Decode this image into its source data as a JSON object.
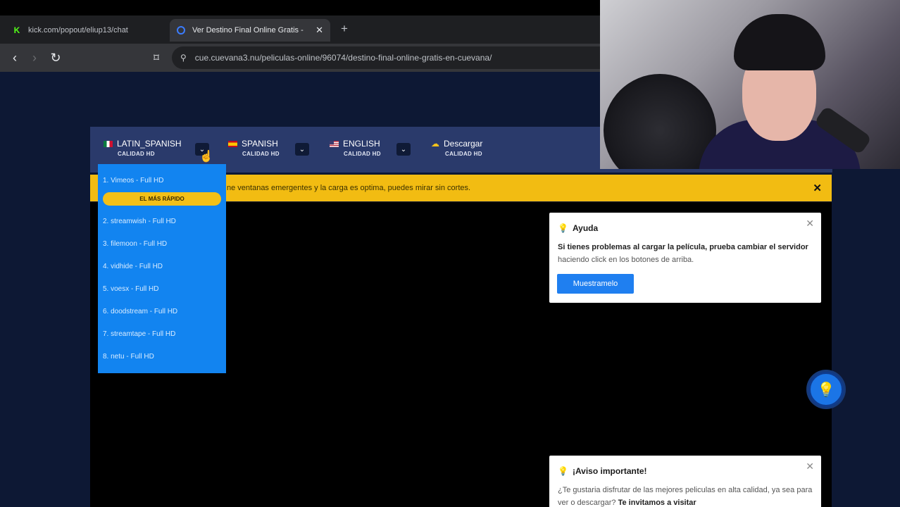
{
  "browser": {
    "tabs": [
      {
        "title": "kick.com/popout/eliup13/chat",
        "favicon": "kick-icon"
      },
      {
        "title": "Ver Destino Final Online Gratis -",
        "favicon": "cuevana-icon"
      }
    ],
    "url": "cue.cuevana3.nu/peliculas-online/96074/destino-final-online-gratis-en-cuevana/"
  },
  "servers": [
    {
      "name": "LATIN_SPANISH",
      "quality": "CALIDAD HD",
      "flag": "mx"
    },
    {
      "name": "SPANISH",
      "quality": "CALIDAD HD",
      "flag": "es"
    },
    {
      "name": "ENGLISH",
      "quality": "CALIDAD HD",
      "flag": "us"
    },
    {
      "name": "Descargar",
      "quality": "CALIDAD HD",
      "icon": "cloud-download-icon"
    }
  ],
  "dropdown": {
    "items": [
      "1. Vimeos - Full HD",
      "2. streamwish - Full HD",
      "3. filemoon - Full HD",
      "4. vidhide - Full HD",
      "5. voesx - Full HD",
      "6. doodstream - Full HD",
      "7. streamtape - Full HD",
      "8. netu - Full HD"
    ],
    "badge": "EL MÁS RÁPIDO"
  },
  "banner": {
    "text": "ne ventanas emergentes y la carga es optima, puedes mirar sin cortes."
  },
  "help_card": {
    "title": "Ayuda",
    "body_bold": "Si tienes problemas al cargar la película, prueba cambiar el servidor",
    "body_rest": " haciendo click en los botones de arriba.",
    "button": "Muestramelo"
  },
  "aviso_card": {
    "title": "¡Aviso importante!",
    "body": "¿Te gustaria disfrutar de las mejores peliculas en alta calidad, ya sea para ver o descargar? ",
    "body_bold": "Te invitamos a visitar"
  },
  "colors": {
    "page_bg": "#0d1834",
    "server_bar": "#2a3a6b",
    "dropdown": "#1284f0",
    "banner": "#f2bc12",
    "accent": "#1f7ff0"
  }
}
